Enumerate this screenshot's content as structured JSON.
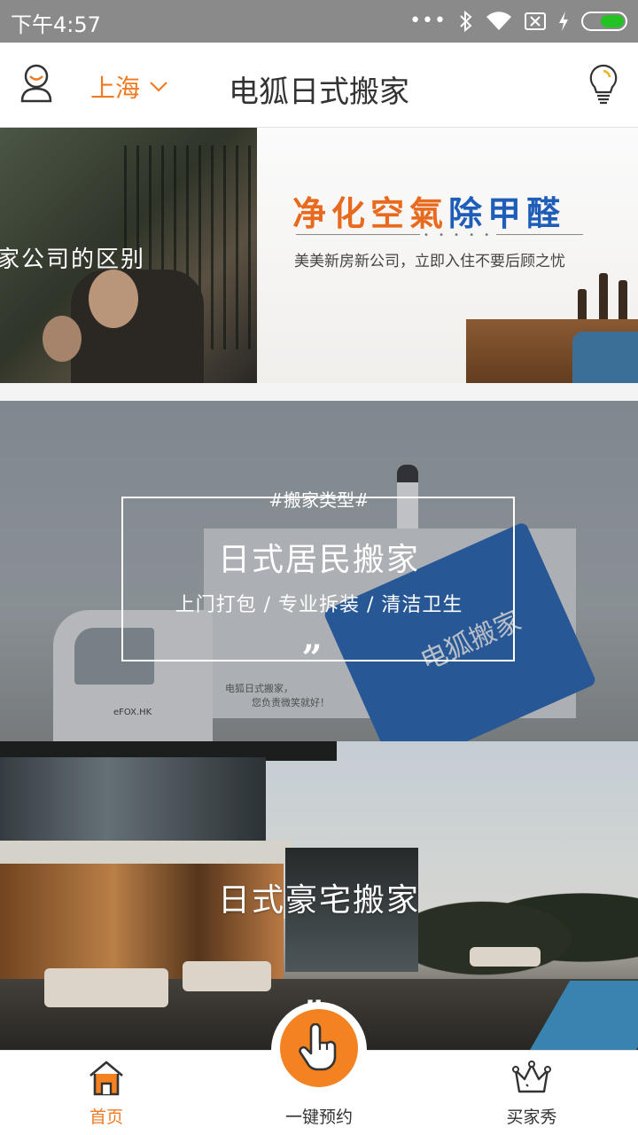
{
  "status_bar": {
    "time": "下午4:57",
    "icons": [
      "more-dots-icon",
      "bluetooth-icon",
      "wifi-icon",
      "no-sim-icon",
      "charging-icon",
      "battery-icon"
    ],
    "battery_color": "#22c322"
  },
  "header": {
    "city": "上海",
    "title": "电狐日式搬家",
    "accent_color": "#f07a22"
  },
  "banner": {
    "left_caption": "家公司的区别",
    "right_headline_orange": "净化空氣",
    "right_headline_blue": "除甲醛",
    "right_dots": "• • • • •",
    "right_subtitle": "美美新房新公司，立即入住不要后顾之忧"
  },
  "card_residential": {
    "tag": "#搬家类型#",
    "title": "日式居民搬家",
    "subtitle": "上门打包 / 专业拆装 / 清洁卫生",
    "quote_mark": "”",
    "truck_logo_text": "电狐搬家",
    "truck_small_line1": "电狐日式搬家，",
    "truck_small_line2": "您负责微笑就好！",
    "truck_plate": "eFOX.HK"
  },
  "card_luxury": {
    "title": "日式豪宅搬家",
    "quote_mark": "”"
  },
  "tabbar": {
    "home_label": "首页",
    "booking_label": "一键预约",
    "show_label": "买家秀",
    "active_color": "#f07a22",
    "fab_color": "#f58220"
  }
}
